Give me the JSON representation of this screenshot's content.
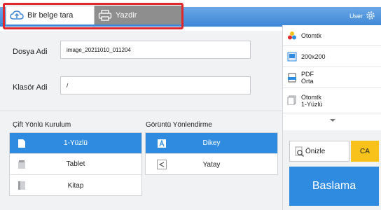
{
  "tabs": [
    {
      "label": "Bir belge tara",
      "icon": "cloud-scan-icon",
      "active": true
    },
    {
      "label": "Yazdir",
      "icon": "printer-icon",
      "active": false
    }
  ],
  "header": {
    "user_label": "User",
    "settings_icon": "gear-icon",
    "accent": "#3d86d6",
    "highlight": "#e0272d"
  },
  "fields": {
    "file_name": {
      "label": "Dosya Adi",
      "value": "image_20211010_011204"
    },
    "folder_name": {
      "label": "Klasör Adi",
      "value": "/"
    }
  },
  "duplex": {
    "title": "Çift Yönlü Kurulum",
    "options": [
      {
        "label": "1-Yüzlü",
        "icon": "single-page-icon",
        "selected": true
      },
      {
        "label": "Tablet",
        "icon": "tablet-binding-icon",
        "selected": false
      },
      {
        "label": "Kitap",
        "icon": "book-binding-icon",
        "selected": false
      }
    ]
  },
  "orientation": {
    "title": "Görüntü Yönlendirme",
    "options": [
      {
        "label": "Dikey",
        "icon": "portrait-icon",
        "selected": true
      },
      {
        "label": "Yatay",
        "icon": "landscape-icon",
        "selected": false
      }
    ]
  },
  "summary": [
    {
      "label": "Otomtk",
      "icon": "color-mode-icon"
    },
    {
      "label": "200x200",
      "icon": "resolution-icon"
    },
    {
      "label": "PDF\nOrta",
      "icon": "file-format-icon"
    },
    {
      "label": "Otomtk\n1-Yüzlü",
      "icon": "original-size-icon"
    }
  ],
  "actions": {
    "preview": "Önizle",
    "ca": "CA",
    "start": "Baslama",
    "start_color": "#2f8be0",
    "ca_color": "#f8c21a"
  }
}
